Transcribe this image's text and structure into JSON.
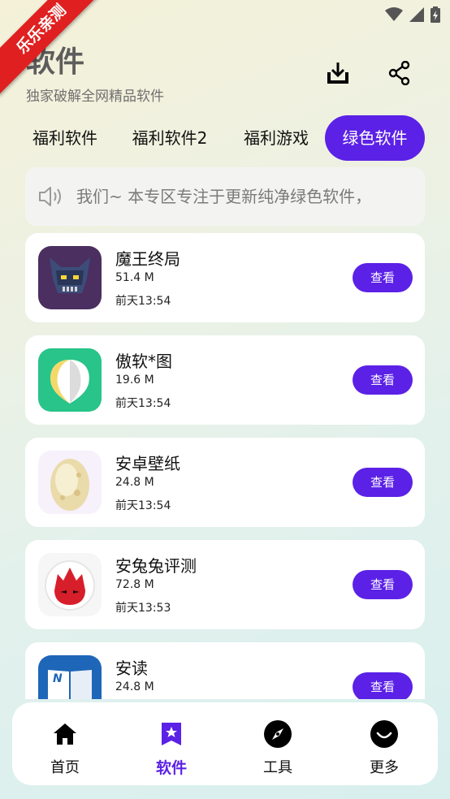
{
  "status_bar": {
    "icons": [
      "wifi-icon",
      "signal-icon",
      "battery-icon"
    ]
  },
  "corner_badge": {
    "text": "乐乐亲测"
  },
  "header": {
    "title": "软件",
    "subtitle": "独家破解全网精品软件",
    "actions": [
      "download-icon",
      "share-icon"
    ]
  },
  "tabs": [
    {
      "label": "福利软件",
      "active": false
    },
    {
      "label": "福利软件2",
      "active": false
    },
    {
      "label": "福利游戏",
      "active": false
    },
    {
      "label": "绿色软件",
      "active": true
    }
  ],
  "notice": {
    "icon": "speaker-icon",
    "text": "我们~   本专区专注于更新纯净绿色软件，"
  },
  "apps": [
    {
      "name": "魔王终局",
      "size": "51.4 M",
      "time": "前天13:54",
      "button": "查看",
      "icon": "demon-king-icon"
    },
    {
      "name": "傲软*图",
      "size": "19.6 M",
      "time": "前天13:54",
      "button": "查看",
      "icon": "apowersoft-icon"
    },
    {
      "name": "安卓壁纸",
      "size": "24.8 M",
      "time": "前天13:54",
      "button": "查看",
      "icon": "egg-icon"
    },
    {
      "name": "安兔兔评测",
      "size": "72.8 M",
      "time": "前天13:53",
      "button": "查看",
      "icon": "antutu-icon"
    },
    {
      "name": "安读",
      "size": "24.8 M",
      "time": "",
      "button": "查看",
      "icon": "book-icon"
    }
  ],
  "bottom_nav": [
    {
      "label": "首页",
      "icon": "home-icon",
      "active": false
    },
    {
      "label": "软件",
      "icon": "bookmark-star-icon",
      "active": true
    },
    {
      "label": "工具",
      "icon": "compass-icon",
      "active": false
    },
    {
      "label": "更多",
      "icon": "smile-icon",
      "active": false
    }
  ],
  "colors": {
    "accent": "#5b21e6",
    "badge": "#e02020"
  }
}
